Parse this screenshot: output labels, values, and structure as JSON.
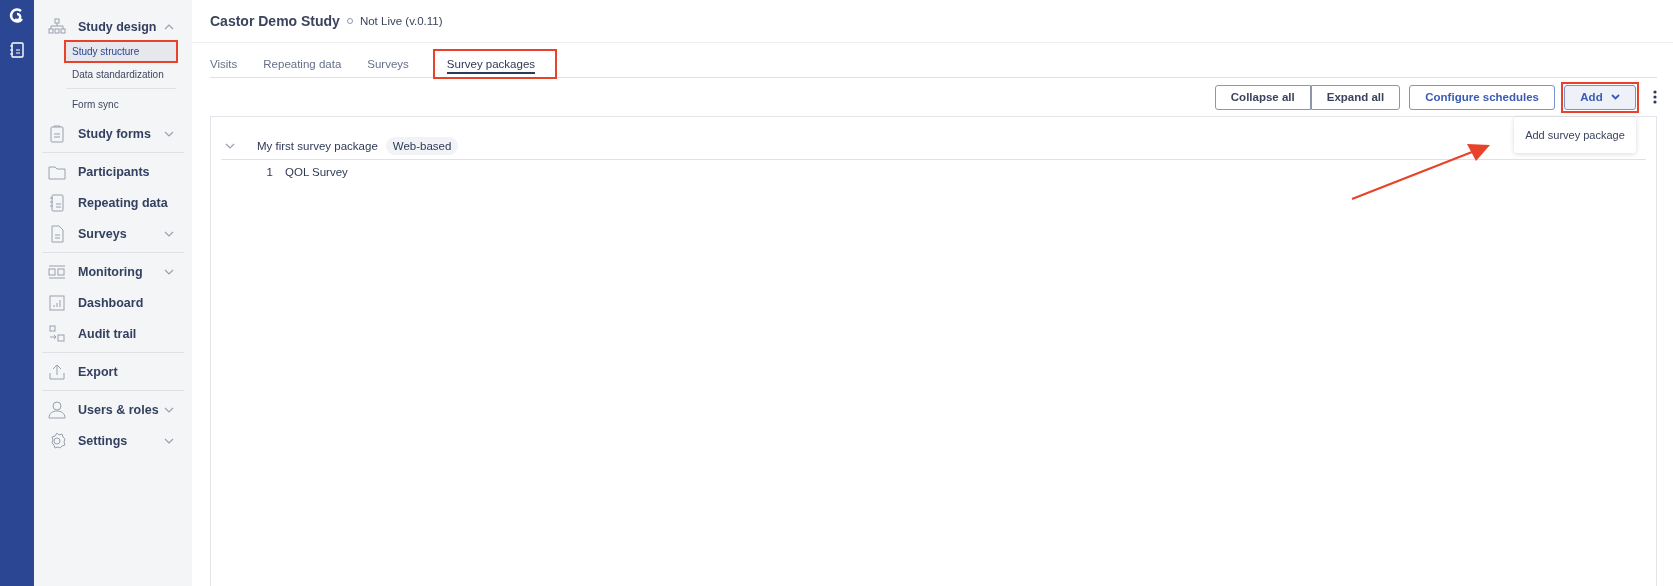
{
  "sidebar": {
    "sections": [
      [
        {
          "label": "Study design",
          "expanded": true,
          "children": [
            {
              "label": "Study structure",
              "selected": true,
              "annotated": true
            },
            {
              "label": "Data standardization",
              "selected": false,
              "annotated": false
            },
            {
              "label": "Form sync",
              "selected": false,
              "annotated": false
            }
          ]
        },
        {
          "label": "Study forms",
          "expanded": false
        }
      ],
      [
        {
          "label": "Participants"
        },
        {
          "label": "Repeating data"
        },
        {
          "label": "Surveys",
          "expanded": false
        }
      ],
      [
        {
          "label": "Monitoring",
          "expanded": false
        },
        {
          "label": "Dashboard"
        },
        {
          "label": "Audit trail"
        }
      ],
      [
        {
          "label": "Export"
        }
      ],
      [
        {
          "label": "Users & roles",
          "expanded": false
        },
        {
          "label": "Settings",
          "expanded": false
        }
      ]
    ]
  },
  "header": {
    "title": "Castor Demo Study",
    "status": "Not Live (v.0.11)"
  },
  "tabs": [
    {
      "label": "Visits",
      "selected": false,
      "annotated": false
    },
    {
      "label": "Repeating data",
      "selected": false,
      "annotated": false
    },
    {
      "label": "Surveys",
      "selected": false,
      "annotated": false
    },
    {
      "label": "Survey packages",
      "selected": true,
      "annotated": true
    }
  ],
  "toolbar": {
    "buttons": [
      {
        "label": "Collapse all",
        "kind": "grouped"
      },
      {
        "label": "Expand all",
        "kind": "grouped"
      },
      {
        "label": "Configure schedules",
        "kind": "outline"
      },
      {
        "label": "Add",
        "kind": "dropdown",
        "annotated": true,
        "expanded": true,
        "menu": [
          "Add survey package"
        ]
      }
    ]
  },
  "packages": [
    {
      "name": "My first survey package",
      "badge": "Web-based",
      "expanded": true,
      "surveys": [
        {
          "number": "1",
          "name": "QOL Survey"
        }
      ]
    }
  ],
  "annotation_arrow": true
}
